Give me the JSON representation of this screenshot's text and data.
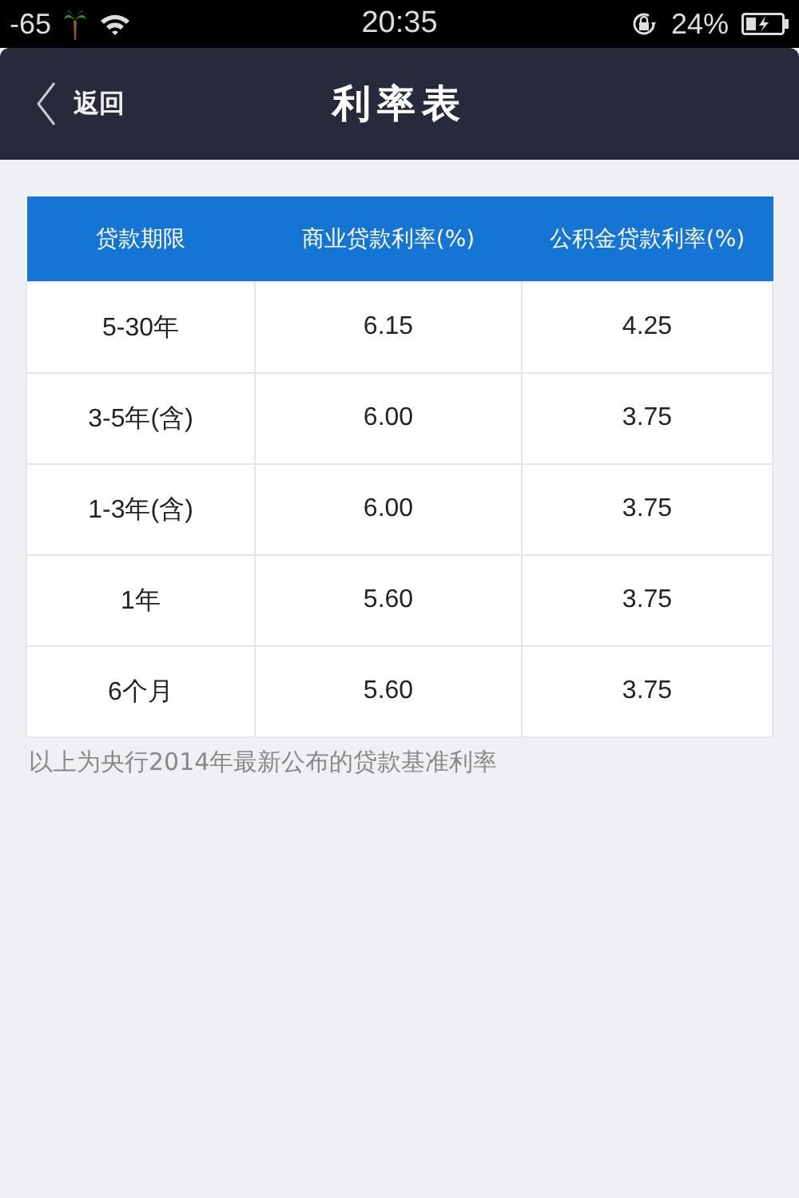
{
  "status_bar": {
    "signal": "-65",
    "time": "20:35",
    "battery": "24%"
  },
  "nav": {
    "back": "返回",
    "title": "利率表"
  },
  "table": {
    "columns": [
      "贷款期限",
      "商业贷款利率(%)",
      "公积金贷款利率(%)"
    ],
    "rows": [
      [
        "5-30年",
        "6.15",
        "4.25"
      ],
      [
        "3-5年(含)",
        "6.00",
        "3.75"
      ],
      [
        "1-3年(含)",
        "6.00",
        "3.75"
      ],
      [
        "1年",
        "5.60",
        "3.75"
      ],
      [
        "6个月",
        "5.60",
        "3.75"
      ]
    ]
  },
  "footnote": "以上为央行2014年最新公布的贷款基准利率"
}
